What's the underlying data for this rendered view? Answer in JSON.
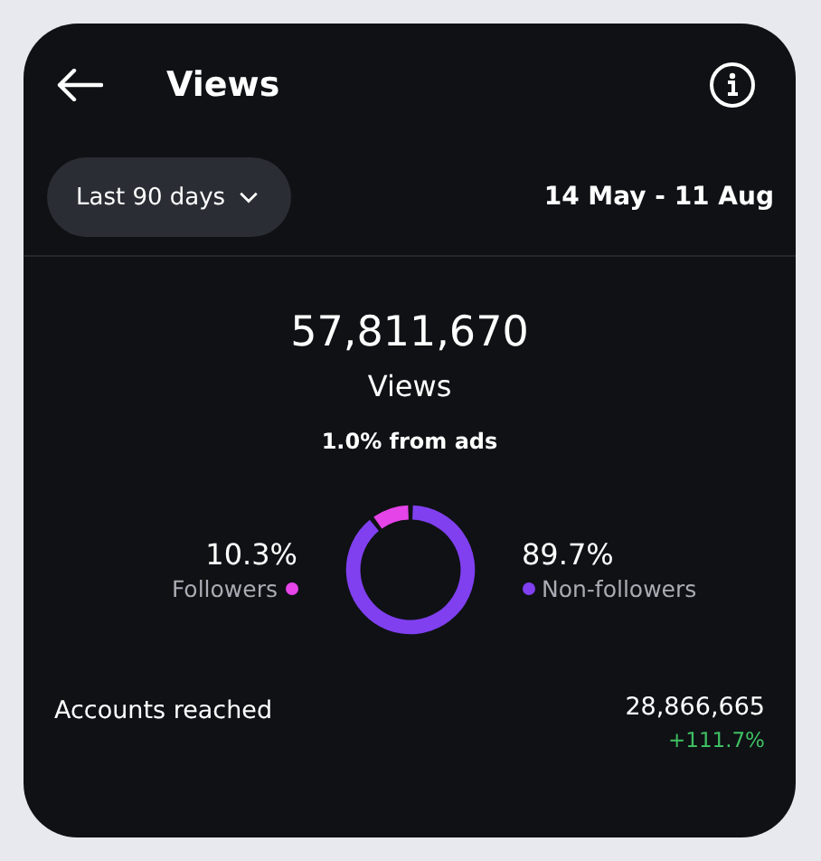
{
  "header": {
    "title": "Views"
  },
  "filter": {
    "label": "Last 90 days",
    "date_range": "14 May - 11 Aug"
  },
  "summary": {
    "total": "57,811,670",
    "label": "Views",
    "ads_note": "1.0% from ads"
  },
  "audience": [
    {
      "percent": "10.3%",
      "color": "#e544e8"
    },
    {
      "percent": "89.7%",
      "color": "#8040f0"
    }
  ],
  "chart_data": {
    "type": "donut",
    "categories": [
      "Followers",
      "Non-followers"
    ],
    "values": [
      10.3,
      89.7
    ]
  },
  "accounts_reached": {
    "label": "Accounts reached",
    "value": "28,866,665",
    "change": "+111.7%"
  }
}
